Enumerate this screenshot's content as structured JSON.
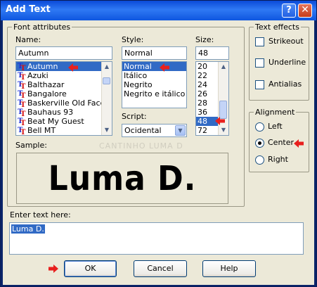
{
  "window": {
    "title": "Add Text",
    "help_glyph": "?",
    "close_glyph": "✕"
  },
  "font_attributes": {
    "group_label": "Font attributes",
    "name_label": "Name:",
    "name_value": "Autumn",
    "fonts": [
      "Autumn",
      "Azuki",
      "Balthazar",
      "Bangalore",
      "Baskerville Old Face",
      "Bauhaus 93",
      "Beat My Guest",
      "Bell MT"
    ],
    "selected_font": "Autumn",
    "style_label": "Style:",
    "style_value": "Normal",
    "styles": [
      "Normal",
      "Itálico",
      "Negrito",
      "Negrito e itálico"
    ],
    "selected_style": "Normal",
    "size_label": "Size:",
    "size_value": "48",
    "sizes": [
      "20",
      "22",
      "24",
      "26",
      "28",
      "36",
      "48",
      "72"
    ],
    "selected_size": "48",
    "script_label": "Script:",
    "script_value": "Ocidental",
    "sample_label": "Sample:",
    "sample_text": "Luma D."
  },
  "text_effects": {
    "group_label": "Text effects",
    "strikeout": {
      "label": "Strikeout",
      "checked": false
    },
    "underline": {
      "label": "Underline",
      "checked": false
    },
    "antialias": {
      "label": "Antialias",
      "checked": false
    }
  },
  "alignment": {
    "group_label": "Alignment",
    "options": [
      "Left",
      "Center",
      "Right"
    ],
    "selected": "Center"
  },
  "enter_text": {
    "label": "Enter text here:",
    "value": "Luma D."
  },
  "watermark": "CANTINHO LUMA D",
  "buttons": {
    "ok": "OK",
    "cancel": "Cancel",
    "help": "Help"
  },
  "colors": {
    "accent": "#316ac5",
    "annotation_arrow": "#e8201e",
    "titlebar": "#0b4ad8"
  },
  "icons": {
    "font_type": "truetype-font-icon",
    "annotation": "red-arrow-icon"
  }
}
